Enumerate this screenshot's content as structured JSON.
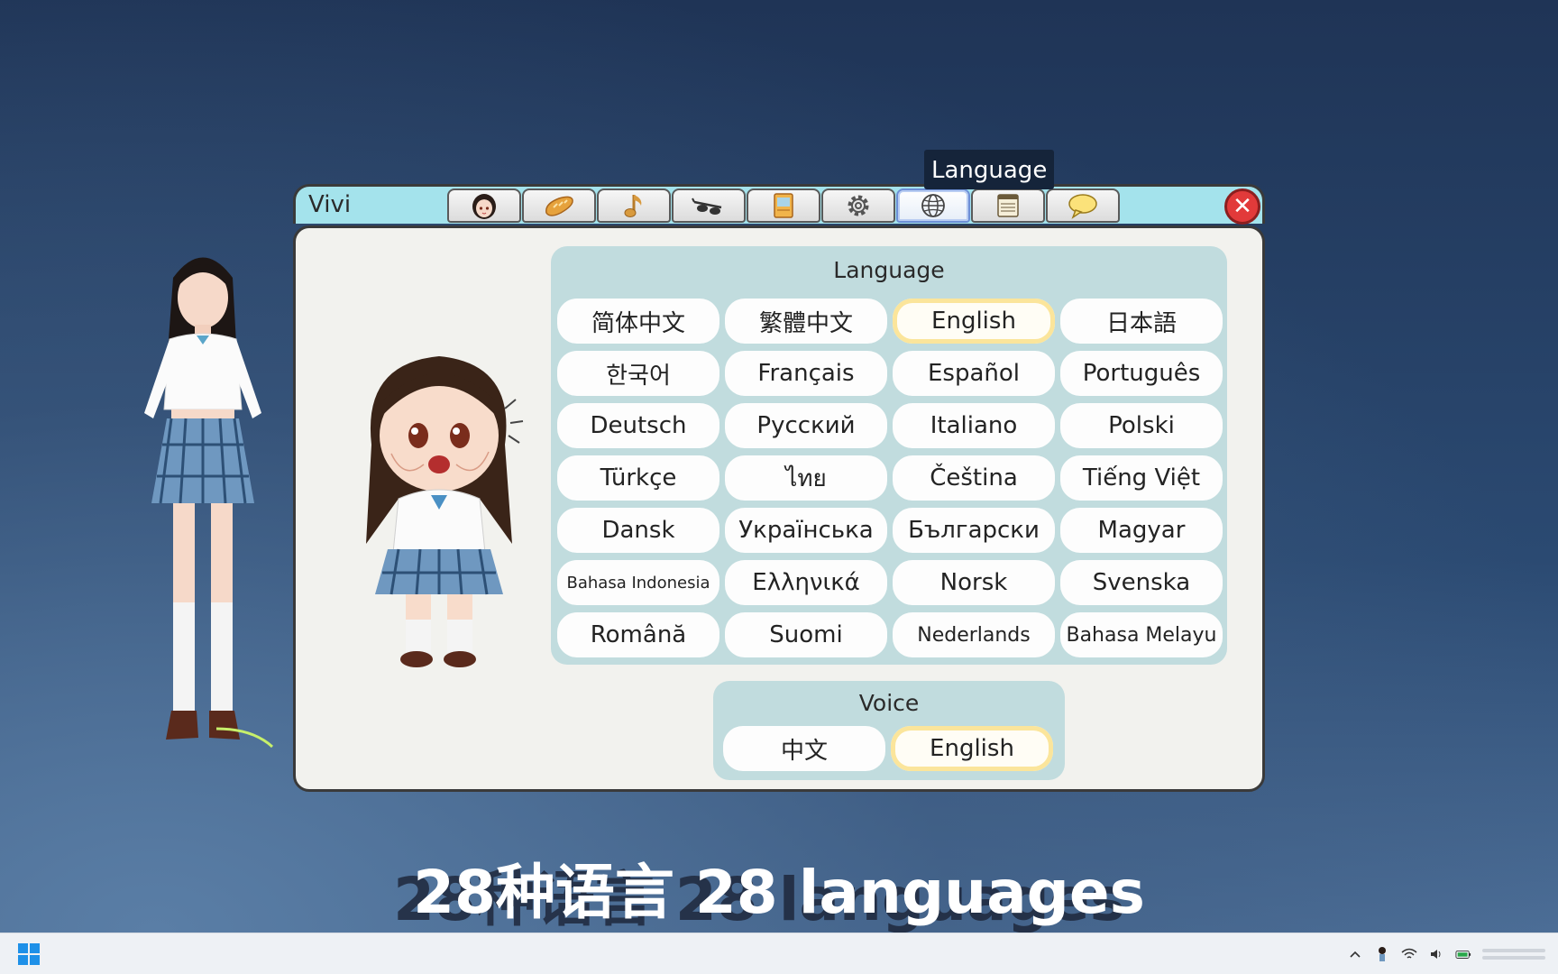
{
  "window": {
    "title": "Vivi",
    "tooltip": "Language",
    "tabs": [
      {
        "name": "character",
        "icon": "character-portrait-icon"
      },
      {
        "name": "food",
        "icon": "bread-icon"
      },
      {
        "name": "music",
        "icon": "music-note-icon"
      },
      {
        "name": "accessories",
        "icon": "glasses-icon"
      },
      {
        "name": "book",
        "icon": "book-icon"
      },
      {
        "name": "settings",
        "icon": "gear-icon"
      },
      {
        "name": "language",
        "icon": "globe-icon",
        "active": true
      },
      {
        "name": "notes",
        "icon": "notebook-icon"
      },
      {
        "name": "chat",
        "icon": "speech-bubble-icon"
      }
    ],
    "close_label": "✕"
  },
  "language": {
    "title": "Language",
    "options": [
      "简体中文",
      "繁體中文",
      "English",
      "日本語",
      "한국어",
      "Français",
      "Español",
      "Português",
      "Deutsch",
      "Русский",
      "Italiano",
      "Polski",
      "Türkçe",
      "ไทย",
      "Čeština",
      "Tiếng Việt",
      "Dansk",
      "Українська",
      "Български",
      "Magyar",
      "Bahasa Indonesia",
      "Ελληνικά",
      "Norsk",
      "Svenska",
      "Română",
      "Suomi",
      "Nederlands",
      "Bahasa Melayu"
    ],
    "selected": "English"
  },
  "voice": {
    "title": "Voice",
    "options": [
      "中文",
      "English"
    ],
    "selected": "English"
  },
  "caption": "28种语言 28 languages",
  "colors": {
    "titlebar": "#a4e3ec",
    "section_bg": "#c1dcde",
    "selected_outline": "#fbe59b",
    "close": "#e23a3a"
  }
}
